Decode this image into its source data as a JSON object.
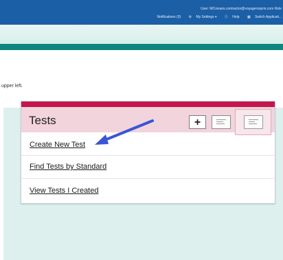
{
  "header": {
    "user_label": "User: MCoivans.contractor@voyagersopris.com",
    "user_suffix": "Role",
    "menu": {
      "notifications": "Notifications (0)",
      "my_settings": "My Settings ▾",
      "help": "Help",
      "switch_app": "Switch Applicati..."
    }
  },
  "instruction_text": "upper left.",
  "tests_panel": {
    "title": "Tests",
    "add_label": "+",
    "links": [
      "Create New Test",
      "Find Tests by Standard",
      "View Tests I Created"
    ]
  },
  "colors": {
    "top_bar": "#1b5fa6",
    "teal_bar": "#0e857d",
    "panel_accent": "#c4164d",
    "panel_header": "#f2d4dc",
    "arrow": "#3a55d6"
  }
}
